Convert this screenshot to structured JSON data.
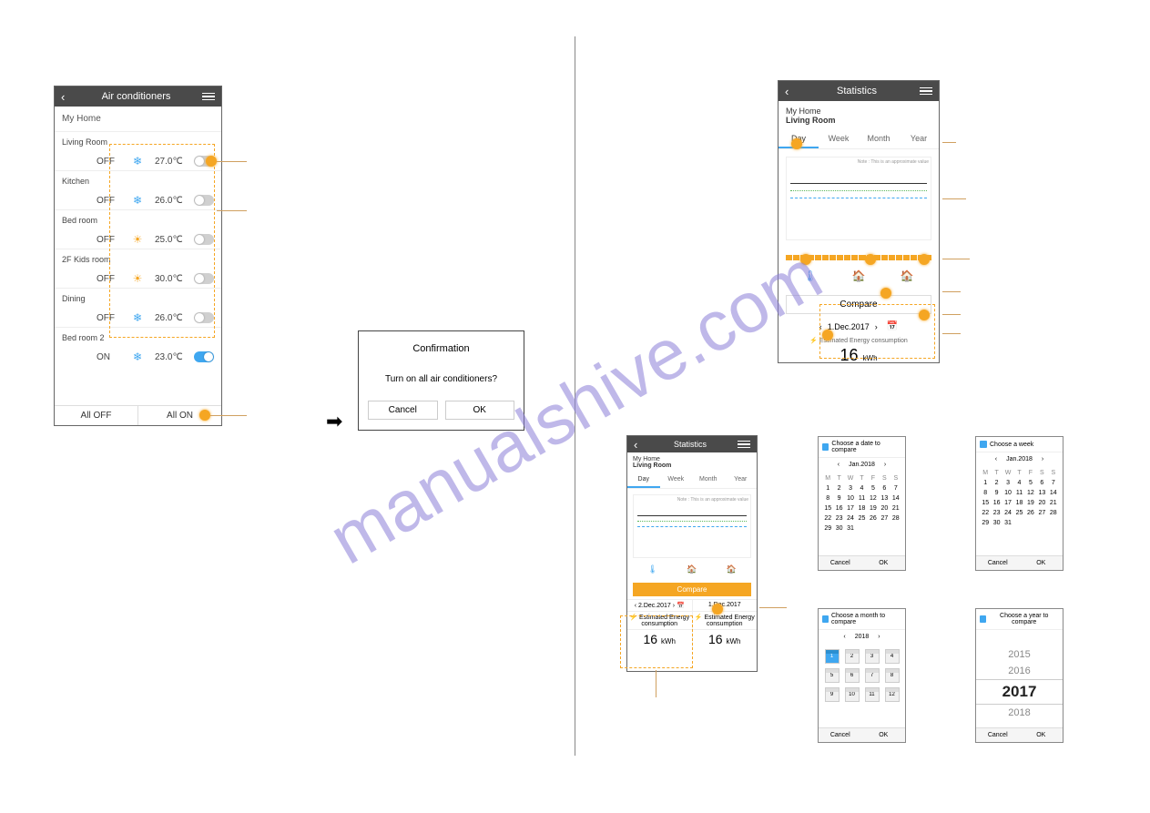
{
  "watermark": "manualshive.com",
  "ac": {
    "title": "Air conditioners",
    "home": "My Home",
    "rows": [
      {
        "name": "Living Room",
        "state": "OFF",
        "mode": "cool",
        "temp": "27.0℃",
        "on": false
      },
      {
        "name": "Kitchen",
        "state": "OFF",
        "mode": "cool",
        "temp": "26.0℃",
        "on": false
      },
      {
        "name": "Bed room",
        "state": "OFF",
        "mode": "heat",
        "temp": "25.0℃",
        "on": false
      },
      {
        "name": "2F Kids room",
        "state": "OFF",
        "mode": "heat",
        "temp": "30.0℃",
        "on": false
      },
      {
        "name": "Dining",
        "state": "OFF",
        "mode": "cool",
        "temp": "26.0℃",
        "on": false
      },
      {
        "name": "Bed room 2",
        "state": "ON",
        "mode": "cool",
        "temp": "23.0℃",
        "on": true
      }
    ],
    "all_off": "All OFF",
    "all_on": "All ON"
  },
  "conf": {
    "title": "Confirmation",
    "msg": "Turn on all air conditioners?",
    "cancel": "Cancel",
    "ok": "OK"
  },
  "stat": {
    "title": "Statistics",
    "home": "My Home",
    "room": "Living Room",
    "tabs": [
      "Day",
      "Week",
      "Month",
      "Year"
    ],
    "note": "Note : This is an approximate value",
    "compare": "Compare",
    "date": "1.Dec.2017",
    "energy_label": "Estimated Energy consumption",
    "energy_val": "16",
    "energy_unit": "kWh",
    "date2": "2.Dec.2017",
    "energy_label_short": "Estimated Energy consumption"
  },
  "cal_date": {
    "title": "Choose a date to compare",
    "month": "Jan.2018",
    "wd": [
      "M",
      "T",
      "W",
      "T",
      "F",
      "S",
      "S"
    ],
    "days": [
      1,
      2,
      3,
      4,
      5,
      6,
      7,
      8,
      9,
      10,
      11,
      12,
      13,
      14,
      15,
      16,
      17,
      18,
      19,
      20,
      21,
      22,
      23,
      24,
      25,
      26,
      27,
      28,
      29,
      30,
      31
    ],
    "cancel": "Cancel",
    "ok": "OK"
  },
  "cal_week": {
    "title": "Choose a week",
    "month": "Jan.2018"
  },
  "cal_month": {
    "title": "Choose a month to compare",
    "year": "2018",
    "months": [
      1,
      2,
      3,
      4,
      5,
      6,
      7,
      8,
      9,
      10,
      11,
      12
    ]
  },
  "cal_year": {
    "title": "Choose a year to compare",
    "years": [
      "2015",
      "2016",
      "2017",
      "2018"
    ]
  },
  "chart_data": {
    "type": "line",
    "title": "",
    "x_range": [
      1,
      30
    ],
    "series_hint": [
      "indoor_temp",
      "outdoor_temp",
      "energy_bars"
    ],
    "note": "approximate daily values, not individually labeled"
  }
}
